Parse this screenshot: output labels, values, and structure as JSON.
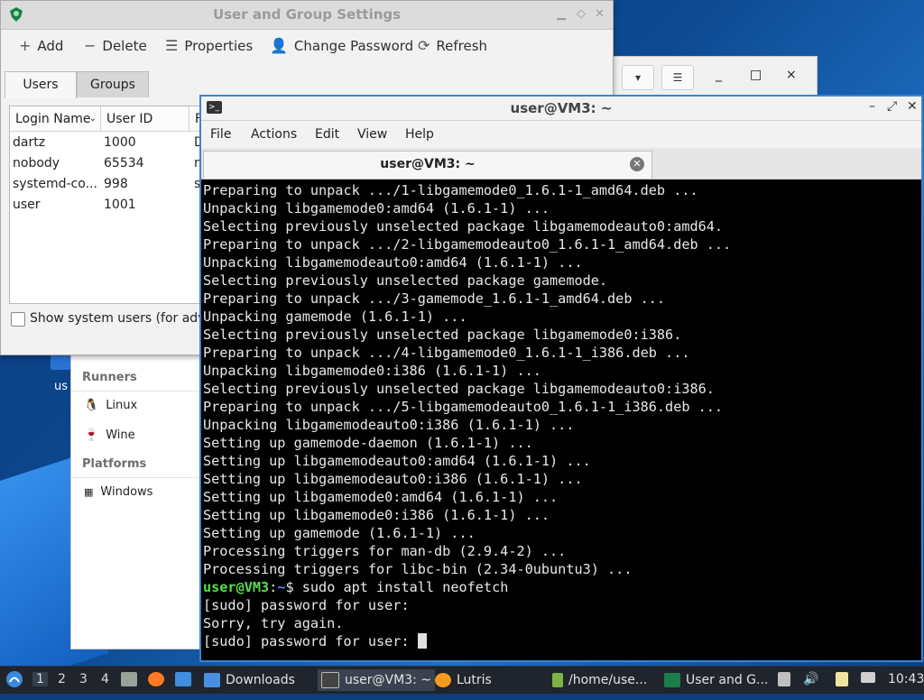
{
  "desktop": {
    "icon_label": "us"
  },
  "lutris": {
    "sections": {
      "runners": "Runners",
      "platforms": "Platforms"
    },
    "runners": [
      {
        "label": "Linux",
        "icon": "penguin-icon"
      },
      {
        "label": "Wine",
        "icon": "wine-icon"
      }
    ],
    "platforms": [
      {
        "label": "Windows",
        "icon": "windows-icon"
      }
    ],
    "controls": {
      "dropdown": "▾",
      "menu": "☰",
      "minimize": "_",
      "maximize": "□",
      "close": "×"
    }
  },
  "ugs": {
    "title": "User and Group Settings",
    "toolbar": {
      "add": "Add",
      "delete": "Delete",
      "properties": "Properties",
      "change_password": "Change Password",
      "refresh": "Refresh"
    },
    "tabs": [
      "Users",
      "Groups"
    ],
    "columns": [
      "Login Name",
      "User ID",
      "F"
    ],
    "rows": [
      {
        "login": "dartz",
        "uid": "1000",
        "extra": "D"
      },
      {
        "login": "nobody",
        "uid": "65534",
        "extra": "n"
      },
      {
        "login": "systemd-co...",
        "uid": "998",
        "extra": "s"
      },
      {
        "login": "user",
        "uid": "1001",
        "extra": ""
      }
    ],
    "show_system_users": "Show system users (for adva"
  },
  "terminal": {
    "title": "user@VM3: ~",
    "menu": [
      "File",
      "Actions",
      "Edit",
      "View",
      "Help"
    ],
    "tab_label": "user@VM3: ~",
    "lines": [
      "Preparing to unpack .../1-libgamemode0_1.6.1-1_amd64.deb ...",
      "Unpacking libgamemode0:amd64 (1.6.1-1) ...",
      "Selecting previously unselected package libgamemodeauto0:amd64.",
      "Preparing to unpack .../2-libgamemodeauto0_1.6.1-1_amd64.deb ...",
      "Unpacking libgamemodeauto0:amd64 (1.6.1-1) ...",
      "Selecting previously unselected package gamemode.",
      "Preparing to unpack .../3-gamemode_1.6.1-1_amd64.deb ...",
      "Unpacking gamemode (1.6.1-1) ...",
      "Selecting previously unselected package libgamemode0:i386.",
      "Preparing to unpack .../4-libgamemode0_1.6.1-1_i386.deb ...",
      "Unpacking libgamemode0:i386 (1.6.1-1) ...",
      "Selecting previously unselected package libgamemodeauto0:i386.",
      "Preparing to unpack .../5-libgamemodeauto0_1.6.1-1_i386.deb ...",
      "Unpacking libgamemodeauto0:i386 (1.6.1-1) ...",
      "Setting up gamemode-daemon (1.6.1-1) ...",
      "Setting up libgamemodeauto0:amd64 (1.6.1-1) ...",
      "Setting up libgamemodeauto0:i386 (1.6.1-1) ...",
      "Setting up libgamemode0:amd64 (1.6.1-1) ...",
      "Setting up libgamemode0:i386 (1.6.1-1) ...",
      "Setting up gamemode (1.6.1-1) ...",
      "Processing triggers for man-db (2.9.4-2) ...",
      "Processing triggers for libc-bin (2.34-0ubuntu3) ..."
    ],
    "prompt_user": "user@VM3",
    "prompt_sep": ":",
    "prompt_path": "~",
    "prompt_dollar": "$ ",
    "command": "sudo apt install neofetch",
    "after": [
      "[sudo] password for user:",
      "Sorry, try again.",
      "[sudo] password for user: "
    ]
  },
  "taskbar": {
    "workspaces": [
      "1",
      "2",
      "3",
      "4"
    ],
    "tasks": [
      {
        "label": "Downloads",
        "icon": "folder-icon"
      },
      {
        "label": "user@VM3: ~",
        "icon": "terminal-icon"
      },
      {
        "label": "Lutris",
        "icon": "lutris-icon"
      },
      {
        "label": "/home/use...",
        "icon": "file-manager-icon"
      },
      {
        "label": "User and G...",
        "icon": "users-icon"
      }
    ],
    "clock": "10:43"
  }
}
